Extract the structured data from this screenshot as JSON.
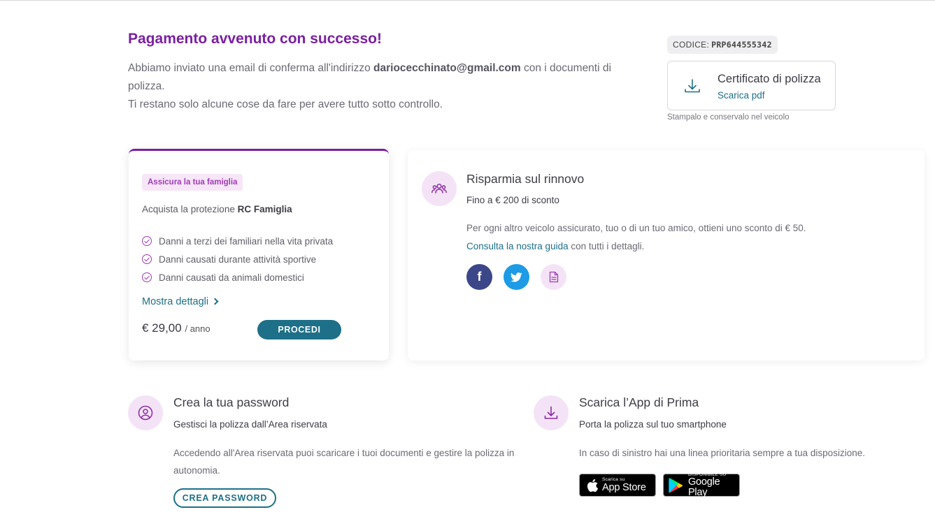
{
  "header": {
    "title": "Pagamento avvenuto con successo!",
    "intro_prefix": "Abbiamo inviato una email di conferma all'indirizzo ",
    "email": "dariocecchinato@gmail.com",
    "intro_suffix": " con i documenti di polizza.",
    "intro_line2": "Ti restano solo alcune cose da fare per avere tutto sotto controllo."
  },
  "code": {
    "label": "CODICE:",
    "value": "PRP644555342"
  },
  "certificate": {
    "title": "Certificato di polizza",
    "link": "Scarica pdf",
    "note": "Stampalo e conservalo nel veicolo",
    "icon": "download-icon"
  },
  "family_card": {
    "tag": "Assicura la tua famiglia",
    "lead_prefix": "Acquista la protezione ",
    "lead_bold": "RC Famiglia",
    "features": [
      "Danni a terzi dei familiari nella vita privata",
      "Danni causati durante attività sportive",
      "Danni causati da animali domestici"
    ],
    "details_link": "Mostra dettagli",
    "price": "€ 29,00",
    "price_unit": "/ anno",
    "cta": "PROCEDI"
  },
  "renewal_card": {
    "title": "Risparmia sul rinnovo",
    "subtitle": "Fino a € 200 di sconto",
    "text": "Per ogni altro veicolo assicurato, tuo o di un tuo amico, ottieni uno sconto di € 50.",
    "guide_link": "Consulta la nostra guida",
    "guide_suffix": " con tutti i dettagli.",
    "icon": "people-icon",
    "social": [
      "facebook-icon",
      "twitter-icon",
      "document-icon"
    ],
    "facebook_glyph": "f"
  },
  "password_section": {
    "title": "Crea la tua password",
    "subtitle": "Gestisci la polizza dall’Area riservata",
    "text": "Accedendo all'Area riservata puoi scaricare i tuoi documenti e gestire la polizza in autonomia.",
    "cta": "CREA PASSWORD",
    "icon": "user-circle-icon"
  },
  "app_section": {
    "title": "Scarica l’App di Prima",
    "subtitle": "Porta la polizza sul tuo smartphone",
    "text": "In caso di sinistro hai una linea prioritaria sempre a tua disposizione.",
    "appstore_small": "Scarica su",
    "appstore_big": "App Store",
    "googleplay_small": "DISPONIBILE SU",
    "googleplay_big": "Google Play",
    "icon": "download-icon"
  },
  "colors": {
    "brand_purple": "#7b1fa2",
    "teal": "#1e6f88",
    "icon_bg": "#f4e3f6",
    "facebook": "#3b4788",
    "twitter": "#1d9be6"
  }
}
